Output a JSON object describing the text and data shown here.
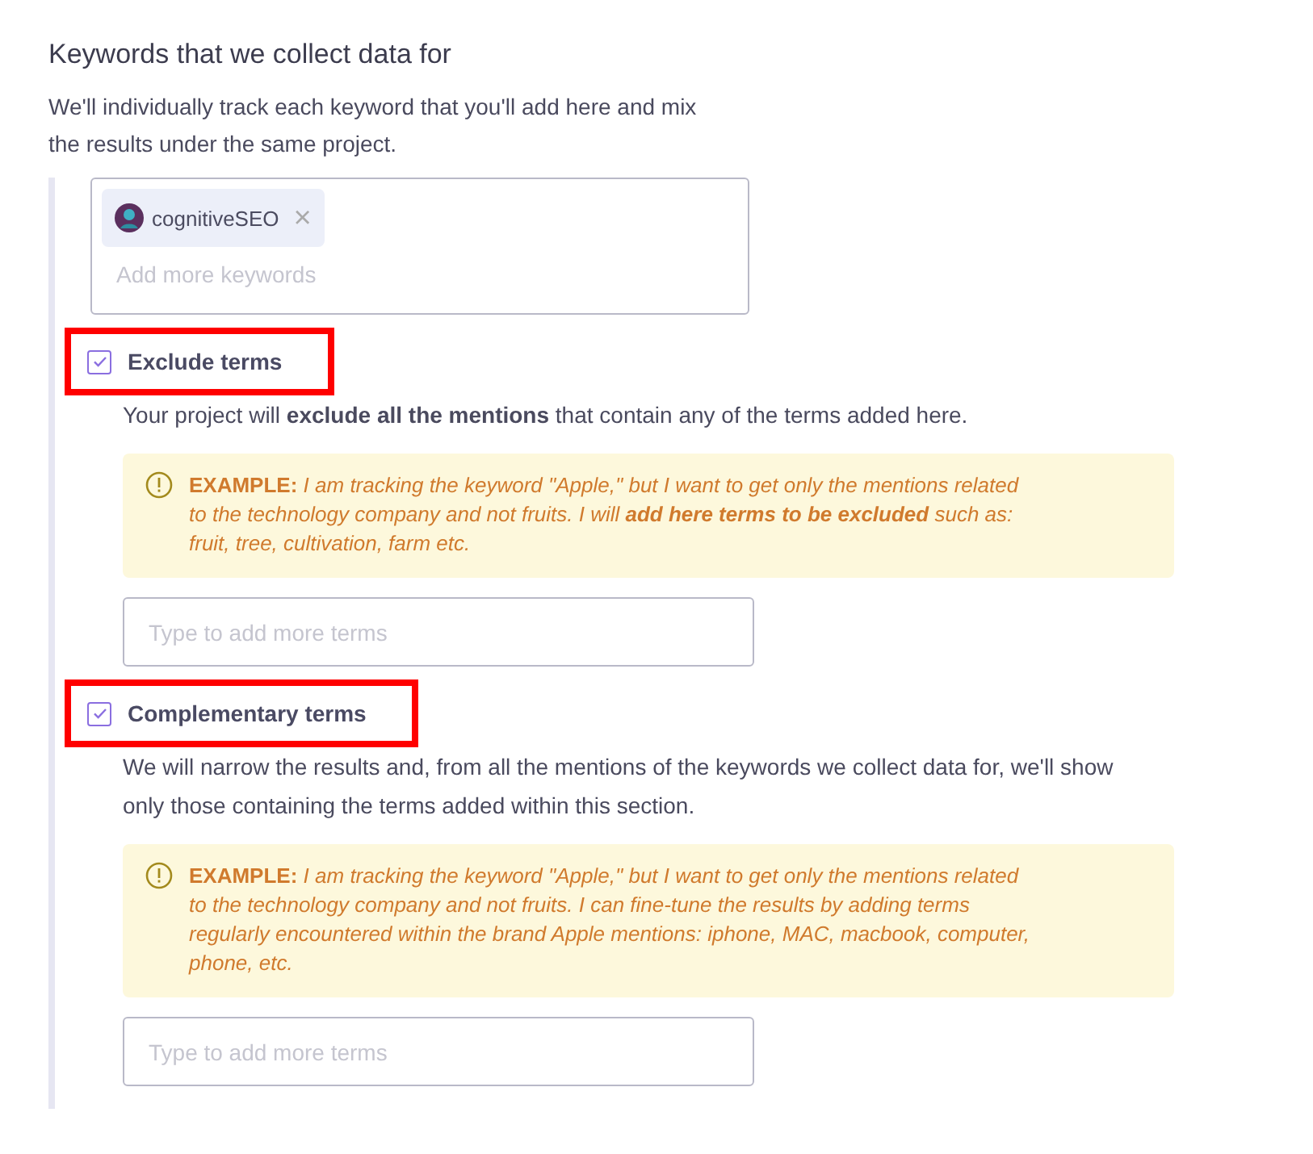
{
  "heading": "Keywords that we collect data for",
  "description": "We'll individually track each keyword that you'll add here and mix the results under the same project.",
  "keywords": {
    "tags": [
      {
        "label": "cognitiveSEO",
        "remove": "×"
      }
    ],
    "placeholder": "Add more keywords"
  },
  "sections": [
    {
      "label": "Exclude terms",
      "checked": true,
      "highlighted": true,
      "description": "Your project will **exclude all the mentions** that contain any of the terms added here.",
      "example_label": "EXAMPLE:",
      "example": "I am tracking the keyword \"Apple,\" but I want to get only the mentions related to the technology company and not fruits. I will **add here terms to be excluded** such as: fruit, tree, cultivation, farm etc.",
      "placeholder": "Type to add more terms"
    },
    {
      "label": "Complementary terms",
      "checked": true,
      "highlighted": true,
      "description": "We will narrow the results and, from all the mentions of the keywords we collect data for, we'll show only those containing the terms added within this section.",
      "example_label": "EXAMPLE:",
      "example": "I am tracking the keyword \"Apple,\" but I want to get only the mentions related to the technology company and not fruits. I can fine-tune the results by adding terms regularly encountered within the brand Apple mentions: iphone, MAC, macbook, computer, phone, etc.",
      "placeholder": "Type to add more terms"
    }
  ]
}
